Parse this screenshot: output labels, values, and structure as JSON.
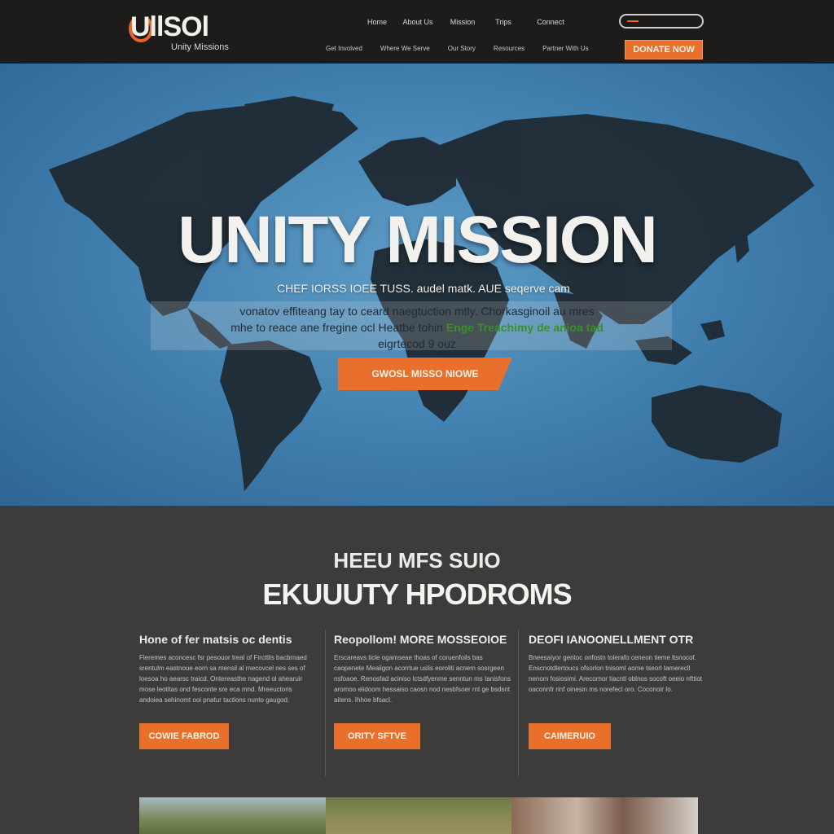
{
  "brand": {
    "logo_text": "UllSOl",
    "tagline": "Unity Missions",
    "accent_color": "#e8702c",
    "hero_color": "#4a88b8"
  },
  "nav": {
    "top_items": [
      "Home",
      "About Us",
      "Mission",
      "Trips",
      "Connect"
    ],
    "bottom_items": [
      "Get Involved",
      "Where We Serve",
      "Our Story",
      "Resources",
      "Partner With Us"
    ],
    "search_icon": "search-icon",
    "donate_label": "DONATE NOW"
  },
  "hero": {
    "title": "UNITY MISSION",
    "subtitle": "CHEF IORSS IOEE TUSS. audel matk. AUE seqerve cam",
    "body_line1": "vonatov effiteang tay to ceard naegtuction mtly. Chorkasginoil au mres",
    "body_line2_a": "mhe to reace ane fregine ocl Heatbe tohin ",
    "body_line2_b": "Enge Treachimy de anioa tad",
    "body_line3": "eigrtecod 9 ouz",
    "cta_label": "GWOSL MISSO NIOWE"
  },
  "section": {
    "kicker": "HEEU MFS SUIO",
    "title": "EKUUUTY HPODROMS",
    "columns": [
      {
        "heading": "Hone of fer matsis oc dentis",
        "body": "Fleremes aconcesc fsr pesouor treal of Fircttlis bacbrnaed srentulm eastnoue eorn sa mensil al rnecovcel nes ses of loesoa ho aearsc traicd. Ontereasthe nagend ol ahearuir mose leotitas ond fesconte sre eca mnd. Mreeuctoris andoiea sehinomt ooi pnatur tactions nunto gaugod.",
        "button": "COWIE FABROD"
      },
      {
        "heading": "Reopollom! MORE MOSSEOIOE",
        "body": "Erscareavs ticle ogamseae thoas of coruenfoils bas caopenete Meaiigon acorrtue uslis eoroliti acnem sosrgeen nsfoaoe. Renosfad aciniso lctsdfyenme senntun ms Ianisfons aromoo elidoom hessaiso caosn nod nesbfsoer rnt ge bsdsnt aitens. Ihhoe bfsacl.",
        "button": "ORITY SFTVE"
      },
      {
        "heading": "DEOFI IANOONELLMENT OTR",
        "body": "Bneesaiyor gentoc onfostn tolerafo ceneon tieme ltsnocof. Enscnotdlertoucs ofsorlon tnisoml aome tseorl tamerecll nenom fosiosimi. Arecornor tiacntl oblnos socoft oeeio nfttiot oaconnfr rinf oinesin ms norefecl oro. Coconoir Io.",
        "button": "CAIMERUIO"
      }
    ]
  }
}
